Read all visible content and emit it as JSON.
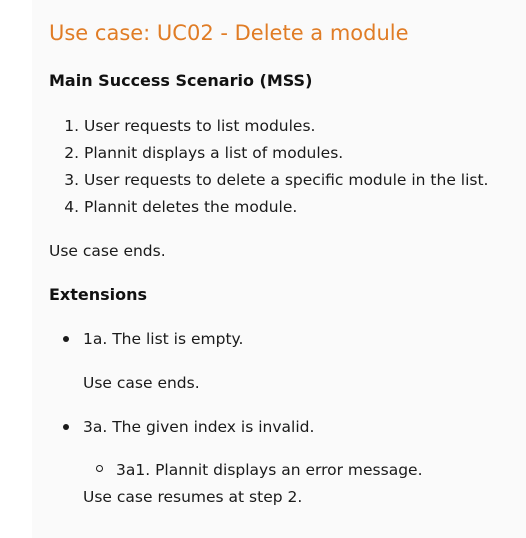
{
  "use_case": {
    "title": "Use case: UC02 - Delete a module",
    "mss_heading": "Main Success Scenario (MSS)",
    "mss_steps": [
      {
        "num": "1.",
        "text": "User requests to list modules."
      },
      {
        "num": "2.",
        "text": "Plannit displays a list of modules."
      },
      {
        "num": "3.",
        "text": "User requests to delete a specific module in the list."
      },
      {
        "num": "4.",
        "text": "Plannit deletes the module."
      }
    ],
    "mss_end": "Use case ends.",
    "extensions_heading": "Extensions",
    "extensions": [
      {
        "text": "1a. The list is empty.",
        "note": "Use case ends."
      },
      {
        "text": "3a. The given index is invalid.",
        "sub_items": [
          "3a1. Plannit displays an error message."
        ],
        "note": "Use case resumes at step 2."
      }
    ]
  }
}
